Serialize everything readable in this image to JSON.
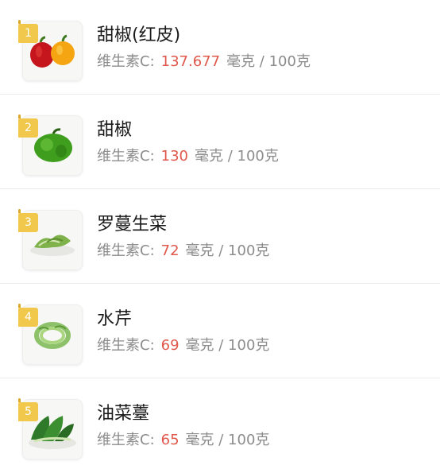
{
  "colors": {
    "value": "#e0574b",
    "label": "#8c8c8c",
    "rank_badge": "#f1c84b",
    "divider": "#ebebeb"
  },
  "items": [
    {
      "rank": "1",
      "name": "甜椒(红皮)",
      "label": "维生素C:",
      "value": "137.677",
      "unit": "毫克 / 100克",
      "image": "red-and-yellow-bell-pepper-image"
    },
    {
      "rank": "2",
      "name": "甜椒",
      "label": "维生素C:",
      "value": "130",
      "unit": "毫克 / 100克",
      "image": "green-bell-pepper-image"
    },
    {
      "rank": "3",
      "name": "罗蔓生菜",
      "label": "维生素C:",
      "value": "72",
      "unit": "毫克 / 100克",
      "image": "romaine-lettuce-image"
    },
    {
      "rank": "4",
      "name": "水芹",
      "label": "维生素C:",
      "value": "69",
      "unit": "毫克 / 100克",
      "image": "water-celery-image"
    },
    {
      "rank": "5",
      "name": "油菜薹",
      "label": "维生素C:",
      "value": "65",
      "unit": "毫克 / 100克",
      "image": "rapeseed-greens-image"
    }
  ]
}
